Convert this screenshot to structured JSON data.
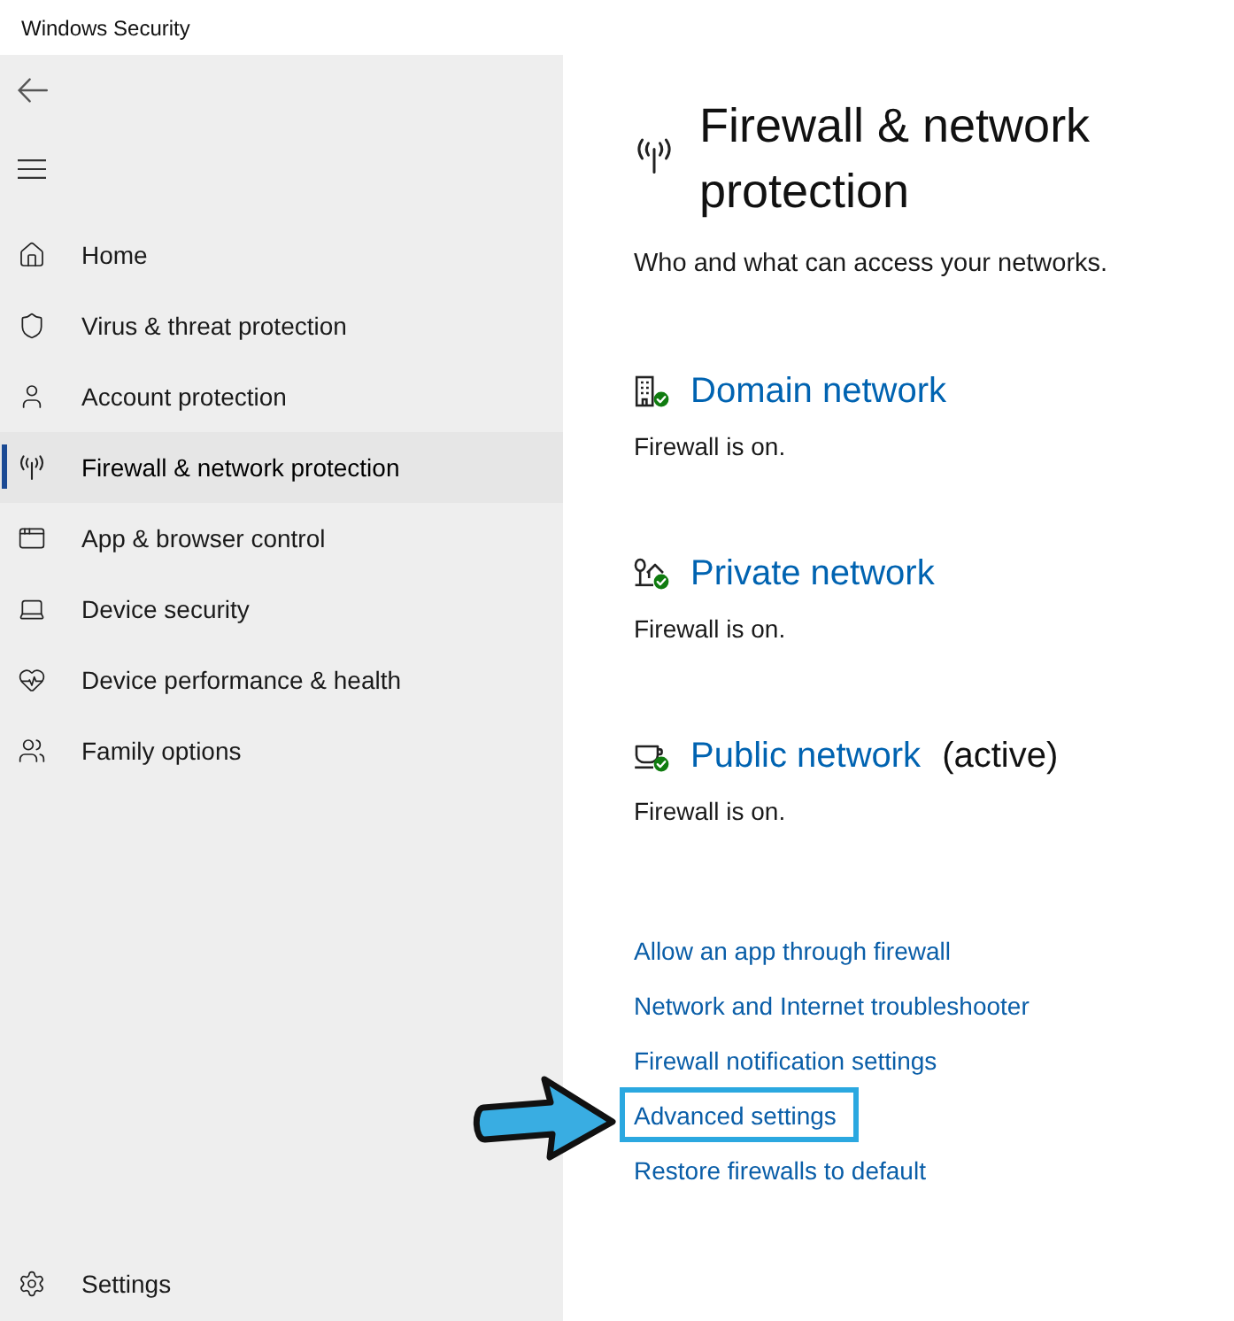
{
  "window": {
    "title": "Windows Security"
  },
  "sidebar": {
    "items": [
      {
        "kind": "home",
        "label": "Home",
        "selected": false
      },
      {
        "kind": "shield",
        "label": "Virus & threat protection",
        "selected": false
      },
      {
        "kind": "account",
        "label": "Account protection",
        "selected": false
      },
      {
        "kind": "firewall",
        "label": "Firewall & network protection",
        "selected": true
      },
      {
        "kind": "app",
        "label": "App & browser control",
        "selected": false
      },
      {
        "kind": "device",
        "label": "Device security",
        "selected": false
      },
      {
        "kind": "health",
        "label": "Device performance & health",
        "selected": false
      },
      {
        "kind": "family",
        "label": "Family options",
        "selected": false
      }
    ],
    "footer": {
      "label": "Settings"
    }
  },
  "page": {
    "title": "Firewall & network protection",
    "subtitle": "Who and what can access your networks.",
    "networks": [
      {
        "kind": "domain",
        "name": "Domain network",
        "secure": true,
        "status": "Firewall is on."
      },
      {
        "kind": "private",
        "name": "Private network",
        "secure": true,
        "status": "Firewall is on."
      },
      {
        "kind": "public",
        "name": "Public network",
        "tag": "(active)",
        "secure": true,
        "status": "Firewall is on."
      }
    ],
    "links": [
      {
        "label": "Allow an app through firewall",
        "highlighted": false
      },
      {
        "label": "Network and Internet troubleshooter",
        "highlighted": false
      },
      {
        "label": "Firewall notification settings",
        "highlighted": false
      },
      {
        "label": "Advanced settings",
        "highlighted": true
      },
      {
        "label": "Restore firewalls to default",
        "highlighted": false
      }
    ]
  }
}
